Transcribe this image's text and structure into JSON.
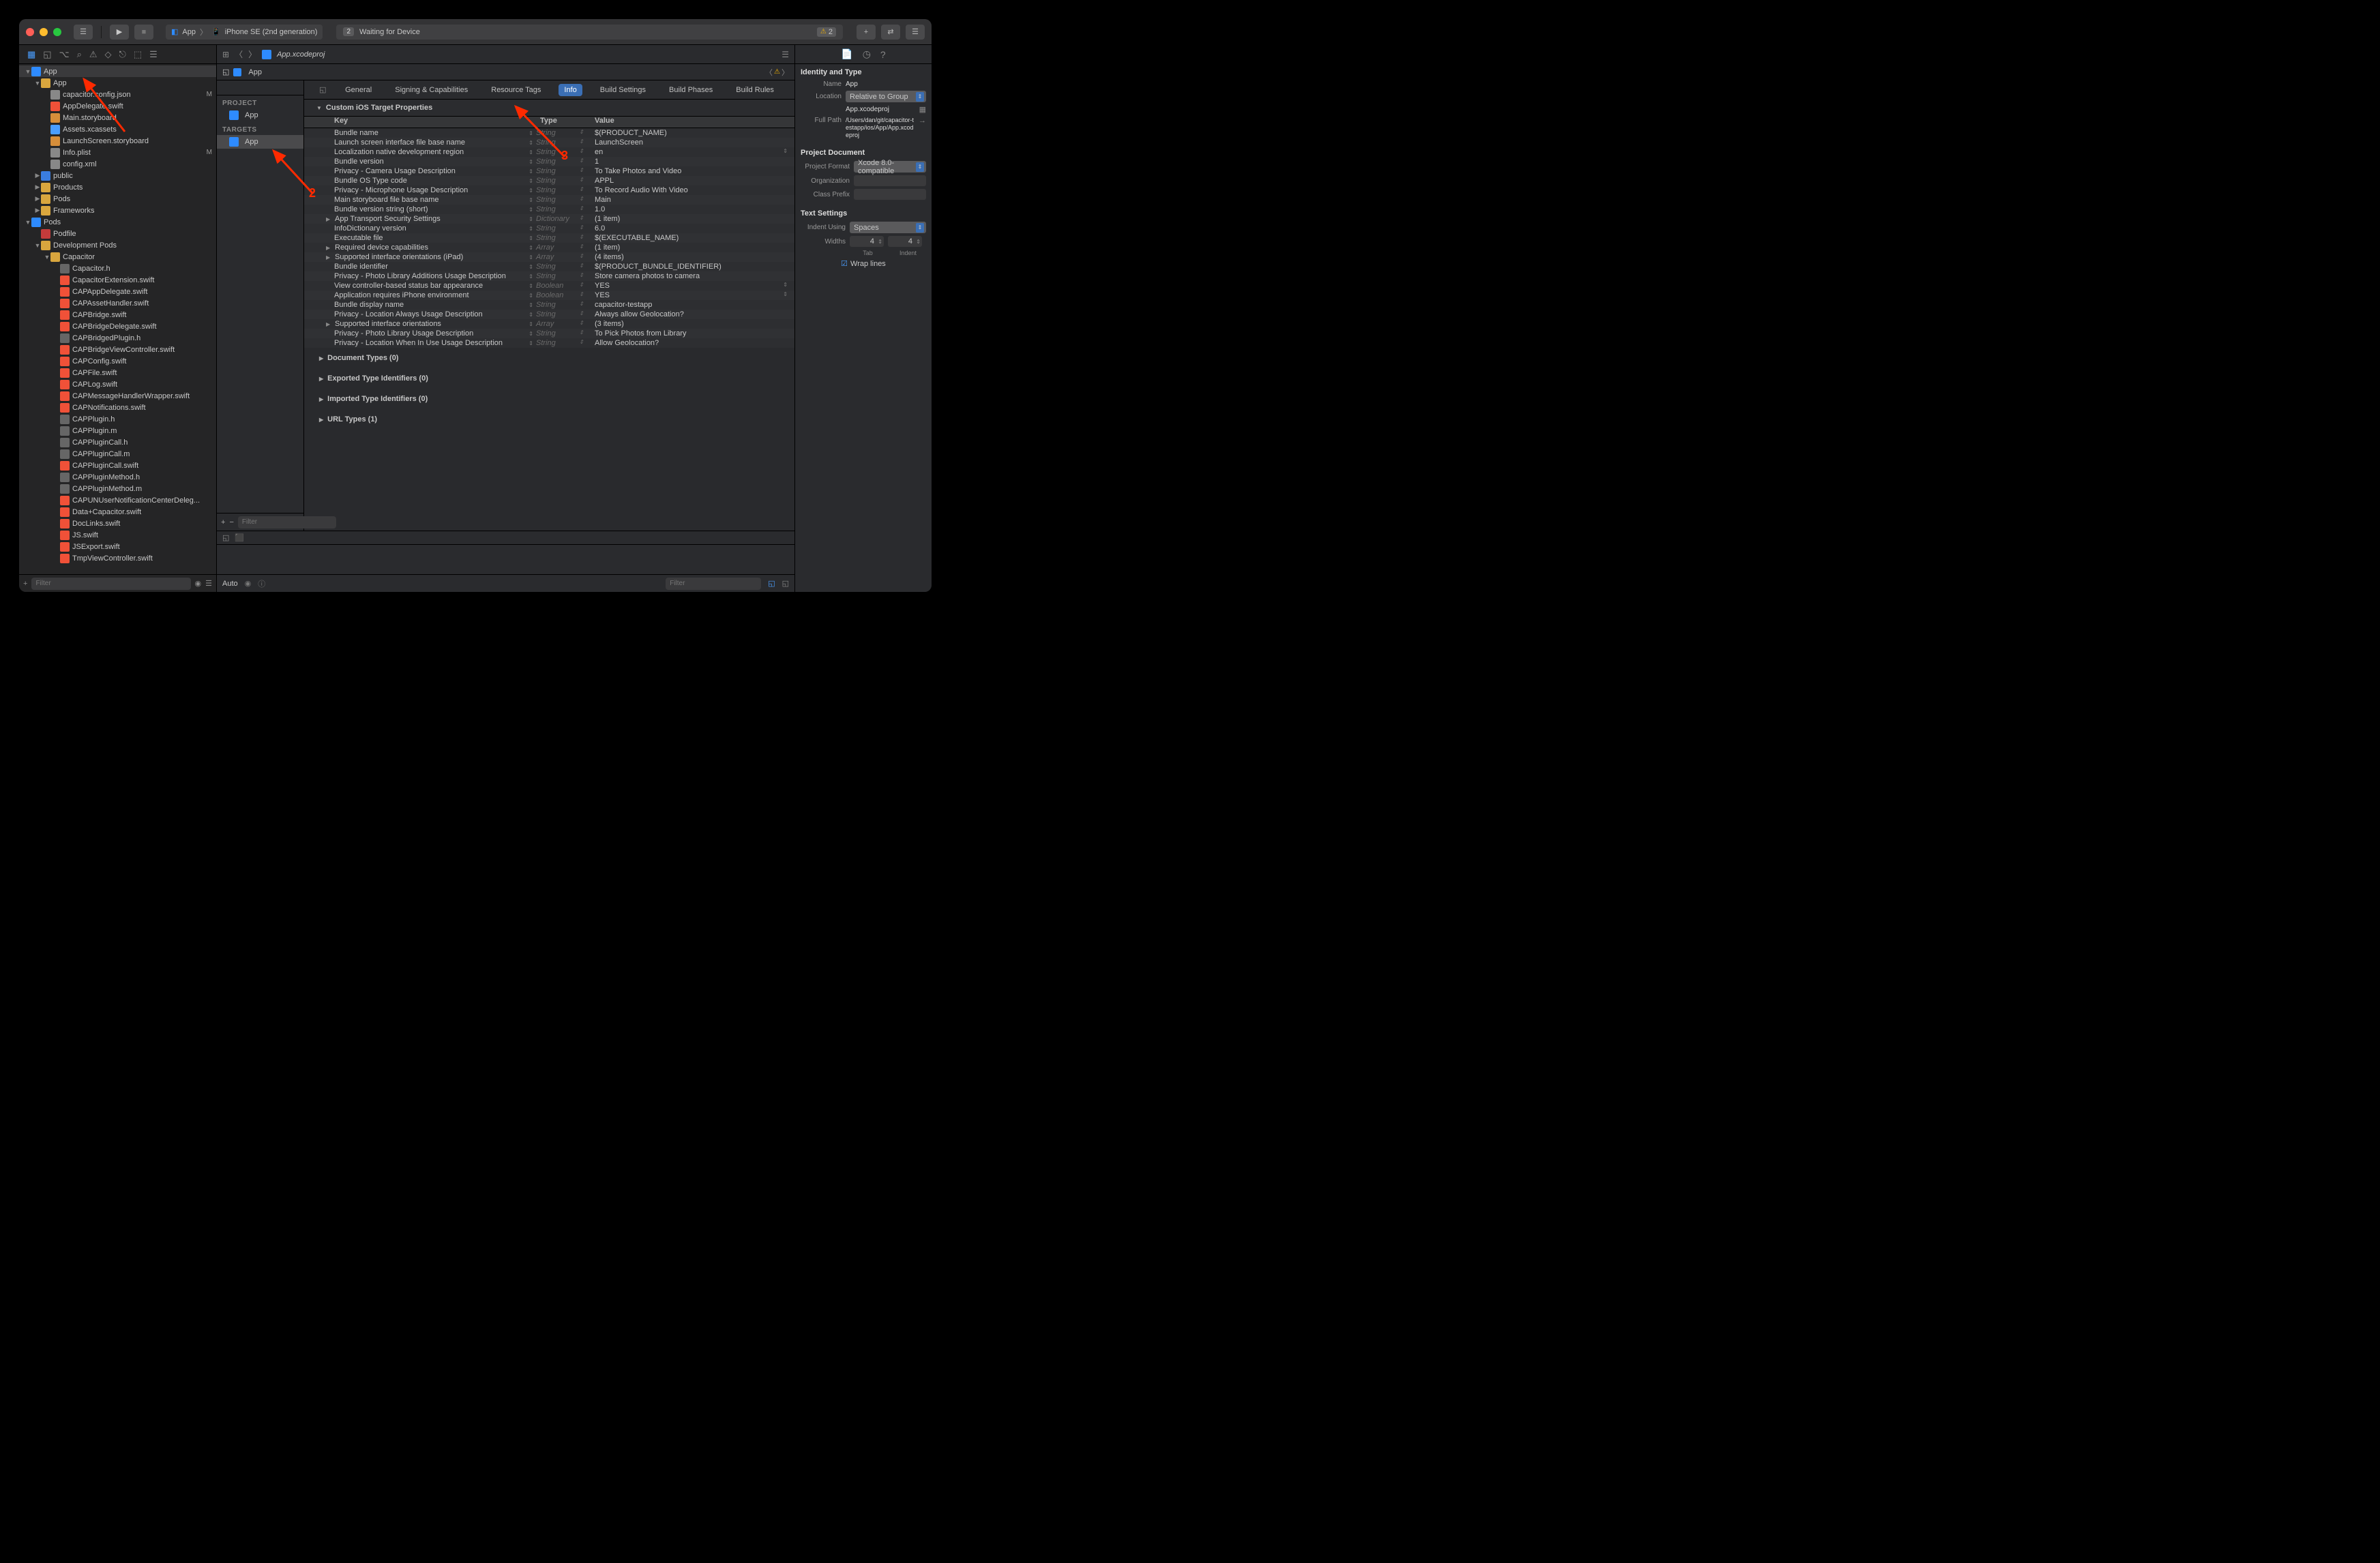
{
  "titlebar": {
    "scheme_app": "App",
    "scheme_device": "iPhone SE (2nd generation)",
    "status_badge": "2",
    "status_text": "Waiting for Device",
    "warn_count": "2"
  },
  "jumpbar_file": "App.xcodeproj",
  "crumb_app": "App",
  "project_section": "PROJECT",
  "project_name": "App",
  "targets_section": "TARGETS",
  "target_name": "App",
  "filter_placeholder": "Filter",
  "tabs": {
    "general": "General",
    "signing": "Signing & Capabilities",
    "resource": "Resource Tags",
    "info": "Info",
    "build_settings": "Build Settings",
    "build_phases": "Build Phases",
    "build_rules": "Build Rules"
  },
  "section_custom": "Custom iOS Target Properties",
  "col_key": "Key",
  "col_type": "Type",
  "col_value": "Value",
  "plist": [
    {
      "k": "Bundle name",
      "t": "String",
      "v": "$(PRODUCT_NAME)"
    },
    {
      "k": "Launch screen interface file base name",
      "t": "String",
      "v": "LaunchScreen"
    },
    {
      "k": "Localization native development region",
      "t": "String",
      "v": "en",
      "vud": true
    },
    {
      "k": "Bundle version",
      "t": "String",
      "v": "1"
    },
    {
      "k": "Privacy - Camera Usage Description",
      "t": "String",
      "v": "To Take Photos and Video"
    },
    {
      "k": "Bundle OS Type code",
      "t": "String",
      "v": "APPL"
    },
    {
      "k": "Privacy - Microphone Usage Description",
      "t": "String",
      "v": "To Record Audio With Video"
    },
    {
      "k": "Main storyboard file base name",
      "t": "String",
      "v": "Main"
    },
    {
      "k": "Bundle version string (short)",
      "t": "String",
      "v": "1.0"
    },
    {
      "k": "App Transport Security Settings",
      "t": "Dictionary",
      "v": "(1 item)",
      "exp": true
    },
    {
      "k": "InfoDictionary version",
      "t": "String",
      "v": "6.0"
    },
    {
      "k": "Executable file",
      "t": "String",
      "v": "$(EXECUTABLE_NAME)"
    },
    {
      "k": "Required device capabilities",
      "t": "Array",
      "v": "(1 item)",
      "exp": true
    },
    {
      "k": "Supported interface orientations (iPad)",
      "t": "Array",
      "v": "(4 items)",
      "exp": true
    },
    {
      "k": "Bundle identifier",
      "t": "String",
      "v": "$(PRODUCT_BUNDLE_IDENTIFIER)"
    },
    {
      "k": "Privacy - Photo Library Additions Usage Description",
      "t": "String",
      "v": "Store camera photos to camera"
    },
    {
      "k": "View controller-based status bar appearance",
      "t": "Boolean",
      "v": "YES",
      "vud": true
    },
    {
      "k": "Application requires iPhone environment",
      "t": "Boolean",
      "v": "YES",
      "vud": true
    },
    {
      "k": "Bundle display name",
      "t": "String",
      "v": "capacitor-testapp"
    },
    {
      "k": "Privacy - Location Always Usage Description",
      "t": "String",
      "v": "Always allow Geolocation?"
    },
    {
      "k": "Supported interface orientations",
      "t": "Array",
      "v": "(3 items)",
      "exp": true
    },
    {
      "k": "Privacy - Photo Library Usage Description",
      "t": "String",
      "v": "To Pick Photos from Library"
    },
    {
      "k": "Privacy - Location When In Use Usage Description",
      "t": "String",
      "v": "Allow Geolocation?"
    }
  ],
  "doc_types": "Document Types (0)",
  "exported_types": "Exported Type Identifiers (0)",
  "imported_types": "Imported Type Identifiers (0)",
  "url_types": "URL Types (1)",
  "debug_auto": "Auto",
  "inspector": {
    "sec1": "Identity and Type",
    "name_lbl": "Name",
    "name_val": "App",
    "loc_lbl": "Location",
    "loc_val": "Relative to Group",
    "filename": "App.xcodeproj",
    "fullpath_lbl": "Full Path",
    "fullpath_val": "/Users/dan/git/capacitor-testapp/ios/App/App.xcodeproj",
    "sec2": "Project Document",
    "format_lbl": "Project Format",
    "format_val": "Xcode 8.0-compatible",
    "org_lbl": "Organization",
    "prefix_lbl": "Class Prefix",
    "sec3": "Text Settings",
    "indent_lbl": "Indent Using",
    "indent_val": "Spaces",
    "widths_lbl": "Widths",
    "width_tab": "4",
    "width_indent": "4",
    "tab_lbl": "Tab",
    "indent_sub": "Indent",
    "wrap": "Wrap lines"
  },
  "tree": [
    {
      "d": 0,
      "ic": "ic-proj",
      "n": "App",
      "sel": true,
      "disc": "▼"
    },
    {
      "d": 1,
      "ic": "ic-fyellow",
      "n": "App",
      "disc": "▼"
    },
    {
      "d": 2,
      "ic": "ic-json",
      "n": "capacitor.config.json",
      "m": "M"
    },
    {
      "d": 2,
      "ic": "ic-swift",
      "n": "AppDelegate.swift"
    },
    {
      "d": 2,
      "ic": "ic-sb",
      "n": "Main.storyboard"
    },
    {
      "d": 2,
      "ic": "ic-xc",
      "n": "Assets.xcassets"
    },
    {
      "d": 2,
      "ic": "ic-sb",
      "n": "LaunchScreen.storyboard"
    },
    {
      "d": 2,
      "ic": "ic-plist",
      "n": "Info.plist",
      "m": "M"
    },
    {
      "d": 2,
      "ic": "ic-xml",
      "n": "config.xml"
    },
    {
      "d": 1,
      "ic": "ic-folder",
      "n": "public",
      "disc": "▶"
    },
    {
      "d": 1,
      "ic": "ic-fyellow",
      "n": "Products",
      "disc": "▶"
    },
    {
      "d": 1,
      "ic": "ic-fyellow",
      "n": "Pods",
      "disc": "▶"
    },
    {
      "d": 1,
      "ic": "ic-fyellow",
      "n": "Frameworks",
      "disc": "▶"
    },
    {
      "d": 0,
      "ic": "ic-proj",
      "n": "Pods",
      "disc": "▼"
    },
    {
      "d": 1,
      "ic": "ic-pod",
      "n": "Podfile"
    },
    {
      "d": 1,
      "ic": "ic-fyellow",
      "n": "Development Pods",
      "disc": "▼"
    },
    {
      "d": 2,
      "ic": "ic-fyellow",
      "n": "Capacitor",
      "disc": "▼"
    },
    {
      "d": 3,
      "ic": "ic-h",
      "n": "Capacitor.h"
    },
    {
      "d": 3,
      "ic": "ic-swift",
      "n": "CapacitorExtension.swift"
    },
    {
      "d": 3,
      "ic": "ic-swift",
      "n": "CAPAppDelegate.swift"
    },
    {
      "d": 3,
      "ic": "ic-swift",
      "n": "CAPAssetHandler.swift"
    },
    {
      "d": 3,
      "ic": "ic-swift",
      "n": "CAPBridge.swift"
    },
    {
      "d": 3,
      "ic": "ic-swift",
      "n": "CAPBridgeDelegate.swift"
    },
    {
      "d": 3,
      "ic": "ic-h",
      "n": "CAPBridgedPlugin.h"
    },
    {
      "d": 3,
      "ic": "ic-swift",
      "n": "CAPBridgeViewController.swift"
    },
    {
      "d": 3,
      "ic": "ic-swift",
      "n": "CAPConfig.swift"
    },
    {
      "d": 3,
      "ic": "ic-swift",
      "n": "CAPFile.swift"
    },
    {
      "d": 3,
      "ic": "ic-swift",
      "n": "CAPLog.swift"
    },
    {
      "d": 3,
      "ic": "ic-swift",
      "n": "CAPMessageHandlerWrapper.swift"
    },
    {
      "d": 3,
      "ic": "ic-swift",
      "n": "CAPNotifications.swift"
    },
    {
      "d": 3,
      "ic": "ic-h",
      "n": "CAPPlugin.h"
    },
    {
      "d": 3,
      "ic": "ic-m",
      "n": "CAPPlugin.m"
    },
    {
      "d": 3,
      "ic": "ic-h",
      "n": "CAPPluginCall.h"
    },
    {
      "d": 3,
      "ic": "ic-m",
      "n": "CAPPluginCall.m"
    },
    {
      "d": 3,
      "ic": "ic-swift",
      "n": "CAPPluginCall.swift"
    },
    {
      "d": 3,
      "ic": "ic-h",
      "n": "CAPPluginMethod.h"
    },
    {
      "d": 3,
      "ic": "ic-m",
      "n": "CAPPluginMethod.m"
    },
    {
      "d": 3,
      "ic": "ic-swift",
      "n": "CAPUNUserNotificationCenterDeleg..."
    },
    {
      "d": 3,
      "ic": "ic-swift",
      "n": "Data+Capacitor.swift"
    },
    {
      "d": 3,
      "ic": "ic-swift",
      "n": "DocLinks.swift"
    },
    {
      "d": 3,
      "ic": "ic-swift",
      "n": "JS.swift"
    },
    {
      "d": 3,
      "ic": "ic-swift",
      "n": "JSExport.swift"
    },
    {
      "d": 3,
      "ic": "ic-swift",
      "n": "TmpViewController.swift"
    }
  ],
  "annotations": {
    "a2": "2",
    "a3": "3"
  }
}
